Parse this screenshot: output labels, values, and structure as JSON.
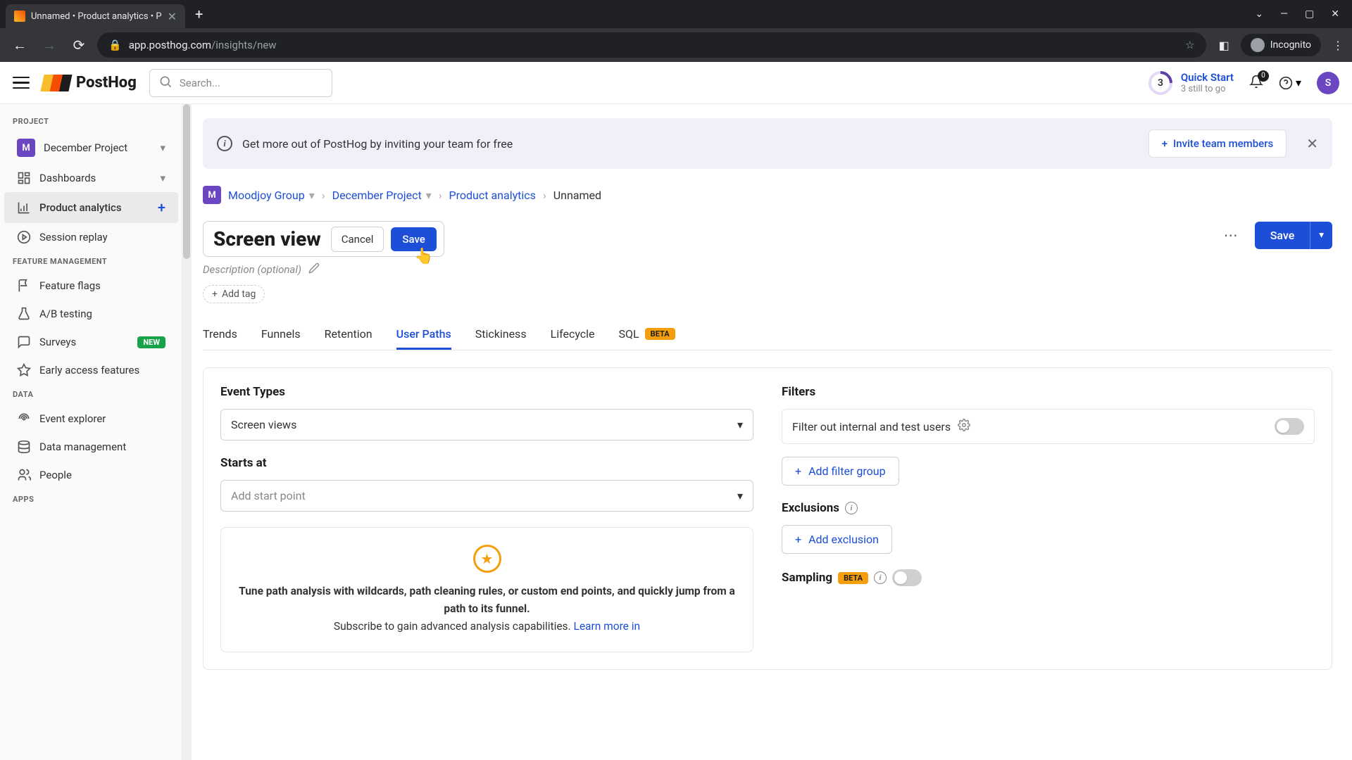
{
  "browser": {
    "tab_title": "Unnamed • Product analytics • P",
    "new_tab": "+",
    "controls": {
      "min": "—",
      "max": "▢",
      "close": "✕",
      "chevron": "⌄"
    },
    "url_host": "app.posthog.com",
    "url_path": "/insights/new",
    "incognito_label": "Incognito"
  },
  "topbar": {
    "logo_text": "PostHog",
    "search_placeholder": "Search...",
    "quick_start": {
      "count": "3",
      "title": "Quick Start",
      "subtitle": "3 still to go"
    },
    "notifications_count": "0",
    "avatar_initial": "S"
  },
  "sidebar": {
    "project_heading": "PROJECT",
    "project_badge": "M",
    "project_name": "December Project",
    "items_main": [
      {
        "icon": "dashboard",
        "label": "Dashboards",
        "trailing": "chevron"
      },
      {
        "icon": "analytics",
        "label": "Product analytics",
        "trailing": "plus",
        "active": true
      },
      {
        "icon": "replay",
        "label": "Session replay"
      }
    ],
    "feature_heading": "FEATURE MANAGEMENT",
    "items_feature": [
      {
        "icon": "flag",
        "label": "Feature flags"
      },
      {
        "icon": "flask",
        "label": "A/B testing"
      },
      {
        "icon": "chat",
        "label": "Surveys",
        "badge": "NEW"
      },
      {
        "icon": "star",
        "label": "Early access features"
      }
    ],
    "data_heading": "DATA",
    "items_data": [
      {
        "icon": "radar",
        "label": "Event explorer"
      },
      {
        "icon": "db",
        "label": "Data management"
      },
      {
        "icon": "people",
        "label": "People"
      }
    ],
    "apps_heading": "APPS"
  },
  "banner": {
    "text": "Get more out of PostHog by inviting your team for free",
    "invite_label": "Invite team members"
  },
  "breadcrumb": {
    "org_badge": "M",
    "org": "Moodjoy Group",
    "project": "December Project",
    "section": "Product analytics",
    "current": "Unnamed"
  },
  "title": {
    "value": "Screen view",
    "cancel": "Cancel",
    "save_name": "Save",
    "description_placeholder": "Description (optional)",
    "add_tag": "Add tag",
    "save": "Save"
  },
  "tabs": [
    {
      "label": "Trends"
    },
    {
      "label": "Funnels"
    },
    {
      "label": "Retention"
    },
    {
      "label": "User Paths",
      "active": true
    },
    {
      "label": "Stickiness"
    },
    {
      "label": "Lifecycle"
    },
    {
      "label": "SQL",
      "beta": "BETA"
    }
  ],
  "config": {
    "event_types_label": "Event Types",
    "event_types_value": "Screen views",
    "starts_at_label": "Starts at",
    "starts_at_placeholder": "Add start point",
    "promo_bold": "Tune path analysis with wildcards, path cleaning rules, or custom end points, and quickly jump from a path to its funnel.",
    "promo_sub": "Subscribe to gain advanced analysis capabilities. ",
    "promo_link": "Learn more in",
    "filters_label": "Filters",
    "filter_internal": "Filter out internal and test users",
    "add_filter_group": "Add filter group",
    "exclusions_label": "Exclusions",
    "add_exclusion": "Add exclusion",
    "sampling_label": "Sampling",
    "sampling_beta": "BETA"
  }
}
